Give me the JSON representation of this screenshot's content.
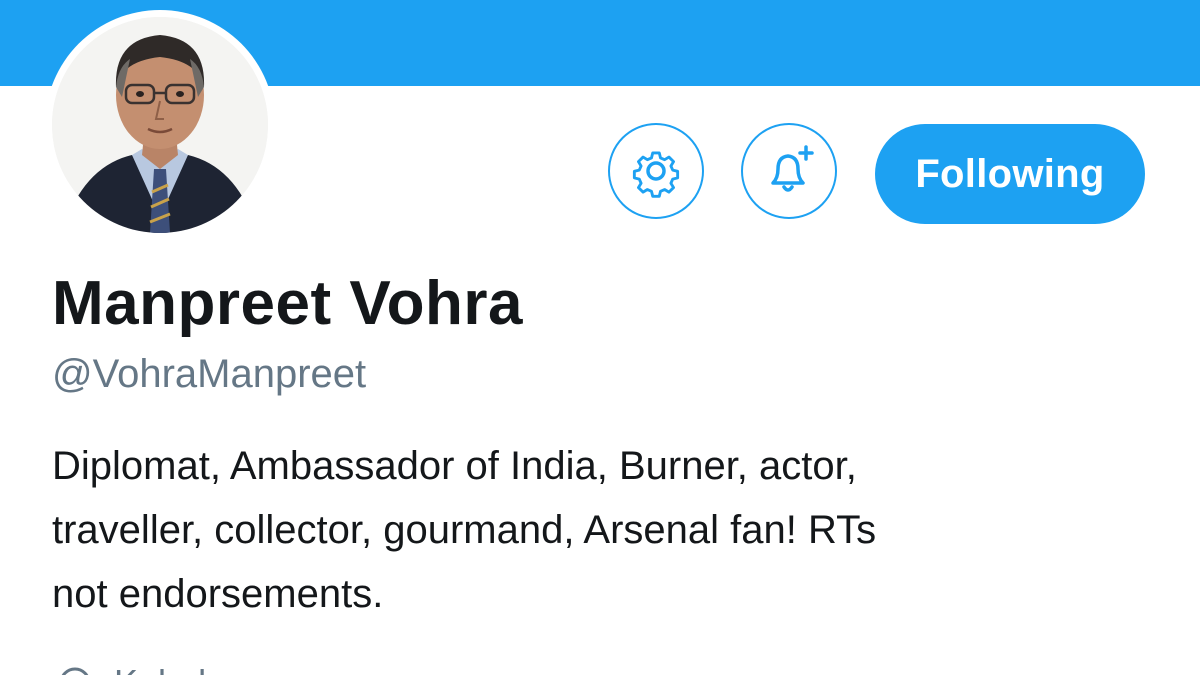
{
  "profile": {
    "name": "Manpreet Vohra",
    "handle": "@VohraManpreet",
    "bio_lines": [
      "Diplomat, Ambassador of India, Burner, actor,",
      "traveller, collector, gourmand, Arsenal fan! RTs",
      "not endorsements."
    ],
    "location": "Kabul"
  },
  "actions": {
    "follow_label": "Following",
    "settings_icon": "gear-icon",
    "notify_icon": "bell-plus-icon"
  },
  "colors": {
    "accent": "#1da1f2",
    "text_primary": "#14171a",
    "text_secondary": "#657786"
  }
}
